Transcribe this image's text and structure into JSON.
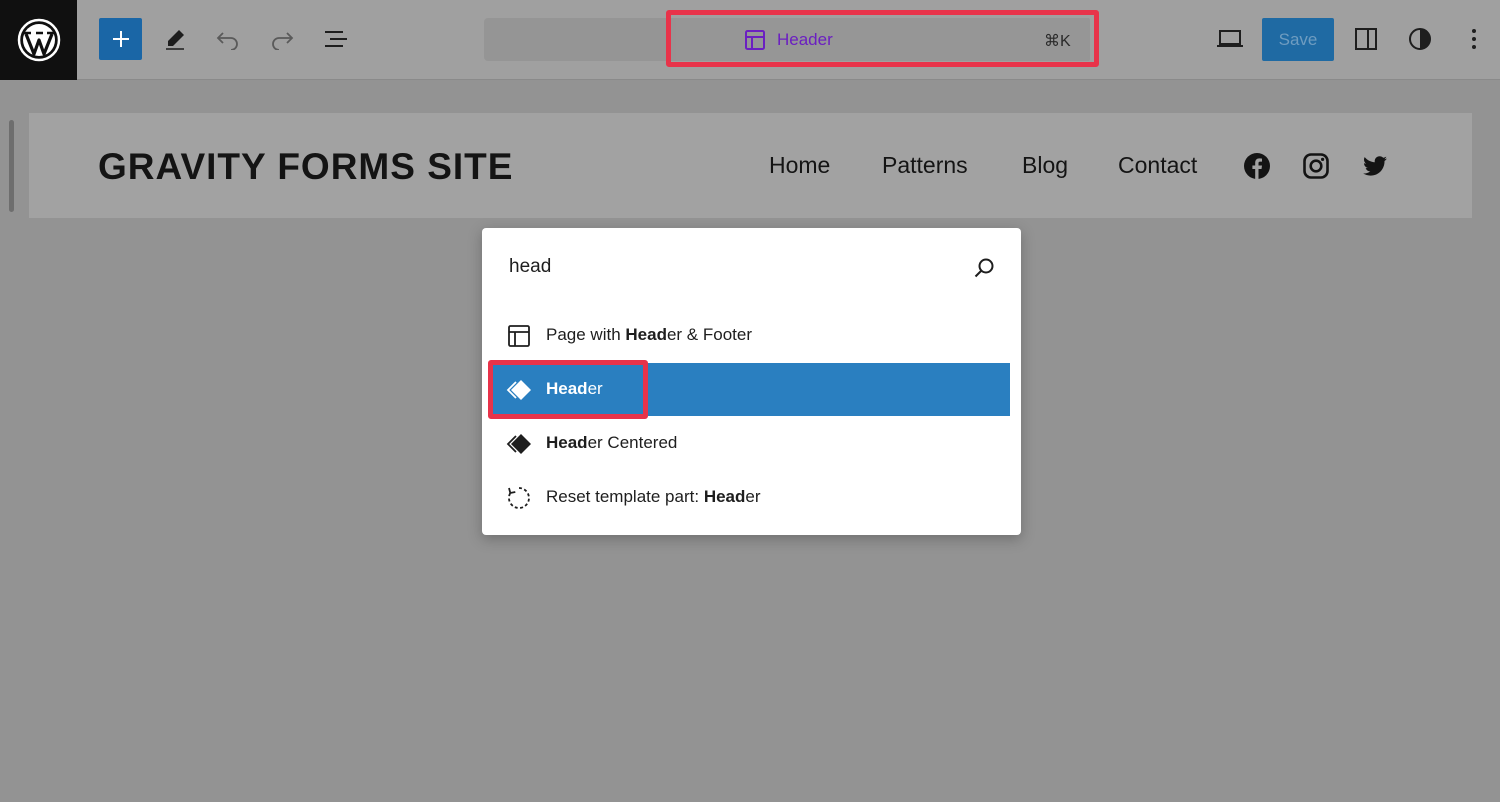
{
  "toolbar": {
    "save_label": "Save",
    "command_bar": {
      "title": "Header",
      "shortcut": "⌘K"
    }
  },
  "site": {
    "title": "GRAVITY FORMS SITE",
    "nav": [
      "Home",
      "Patterns",
      "Blog",
      "Contact"
    ],
    "social": [
      "facebook-icon",
      "instagram-icon",
      "twitter-icon"
    ]
  },
  "palette": {
    "query": "head",
    "items": [
      {
        "icon": "layout-icon",
        "pre": "Page with ",
        "match": "Head",
        "post": "er & Footer",
        "selected": false
      },
      {
        "icon": "symbol-icon",
        "pre": "",
        "match": "Head",
        "post": "er",
        "selected": true
      },
      {
        "icon": "symbol-icon",
        "pre": "",
        "match": "Head",
        "post": "er Centered",
        "selected": false
      },
      {
        "icon": "reset-icon",
        "pre": "Reset template part: ",
        "match": "Head",
        "post": "er",
        "selected": false
      }
    ]
  },
  "colors": {
    "accent": "#2a7fc0",
    "highlight": "#e8334a",
    "command_title": "#6b1fc1"
  }
}
